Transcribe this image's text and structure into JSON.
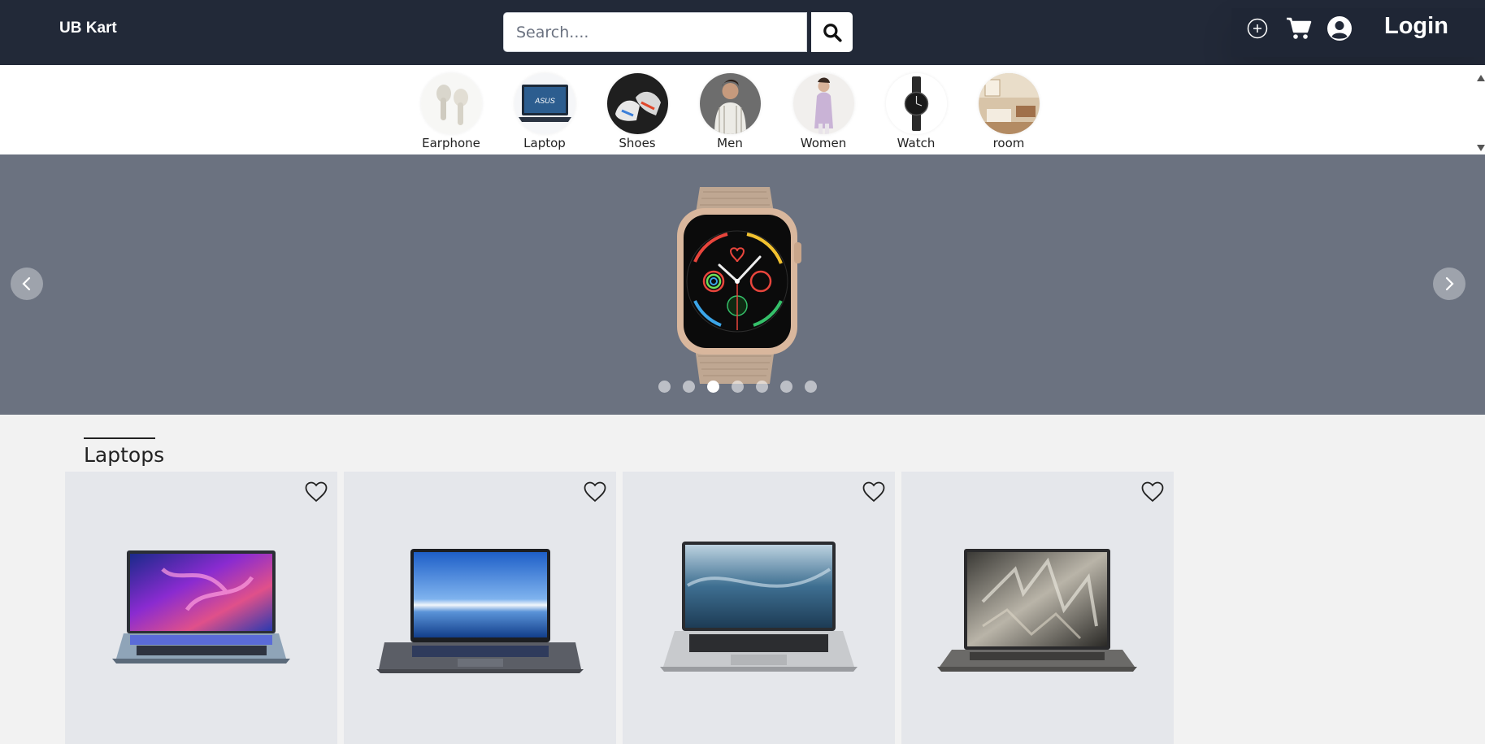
{
  "header": {
    "brand": "UB Kart",
    "search": {
      "placeholder": "Search....",
      "value": ""
    },
    "icons": [
      "plus-circle-icon",
      "cart-icon",
      "user-circle-icon",
      "search-icon"
    ],
    "login_label": "Login"
  },
  "categories": [
    {
      "label": "Earphone",
      "icon": "earphone"
    },
    {
      "label": "Laptop",
      "icon": "laptop"
    },
    {
      "label": "Shoes",
      "icon": "shoes"
    },
    {
      "label": "Men",
      "icon": "men"
    },
    {
      "label": "Women",
      "icon": "women"
    },
    {
      "label": "Watch",
      "icon": "watch"
    },
    {
      "label": "room",
      "icon": "room"
    }
  ],
  "carousel": {
    "slide_count": 7,
    "active_index": 2,
    "current_image": "smartwatch",
    "background": "#6b7280"
  },
  "section": {
    "title": "Laptops",
    "products": [
      {
        "image": "dual-screen-laptop",
        "icon": "heart-icon"
      },
      {
        "image": "laptop-blue-screen",
        "icon": "heart-icon"
      },
      {
        "image": "laptop-silver",
        "icon": "heart-icon"
      },
      {
        "image": "laptop-dark",
        "icon": "heart-icon"
      }
    ]
  },
  "colors": {
    "header_bg": "#222938",
    "page_bg": "#f2f2f2",
    "card_bg": "#e5e7eb"
  }
}
